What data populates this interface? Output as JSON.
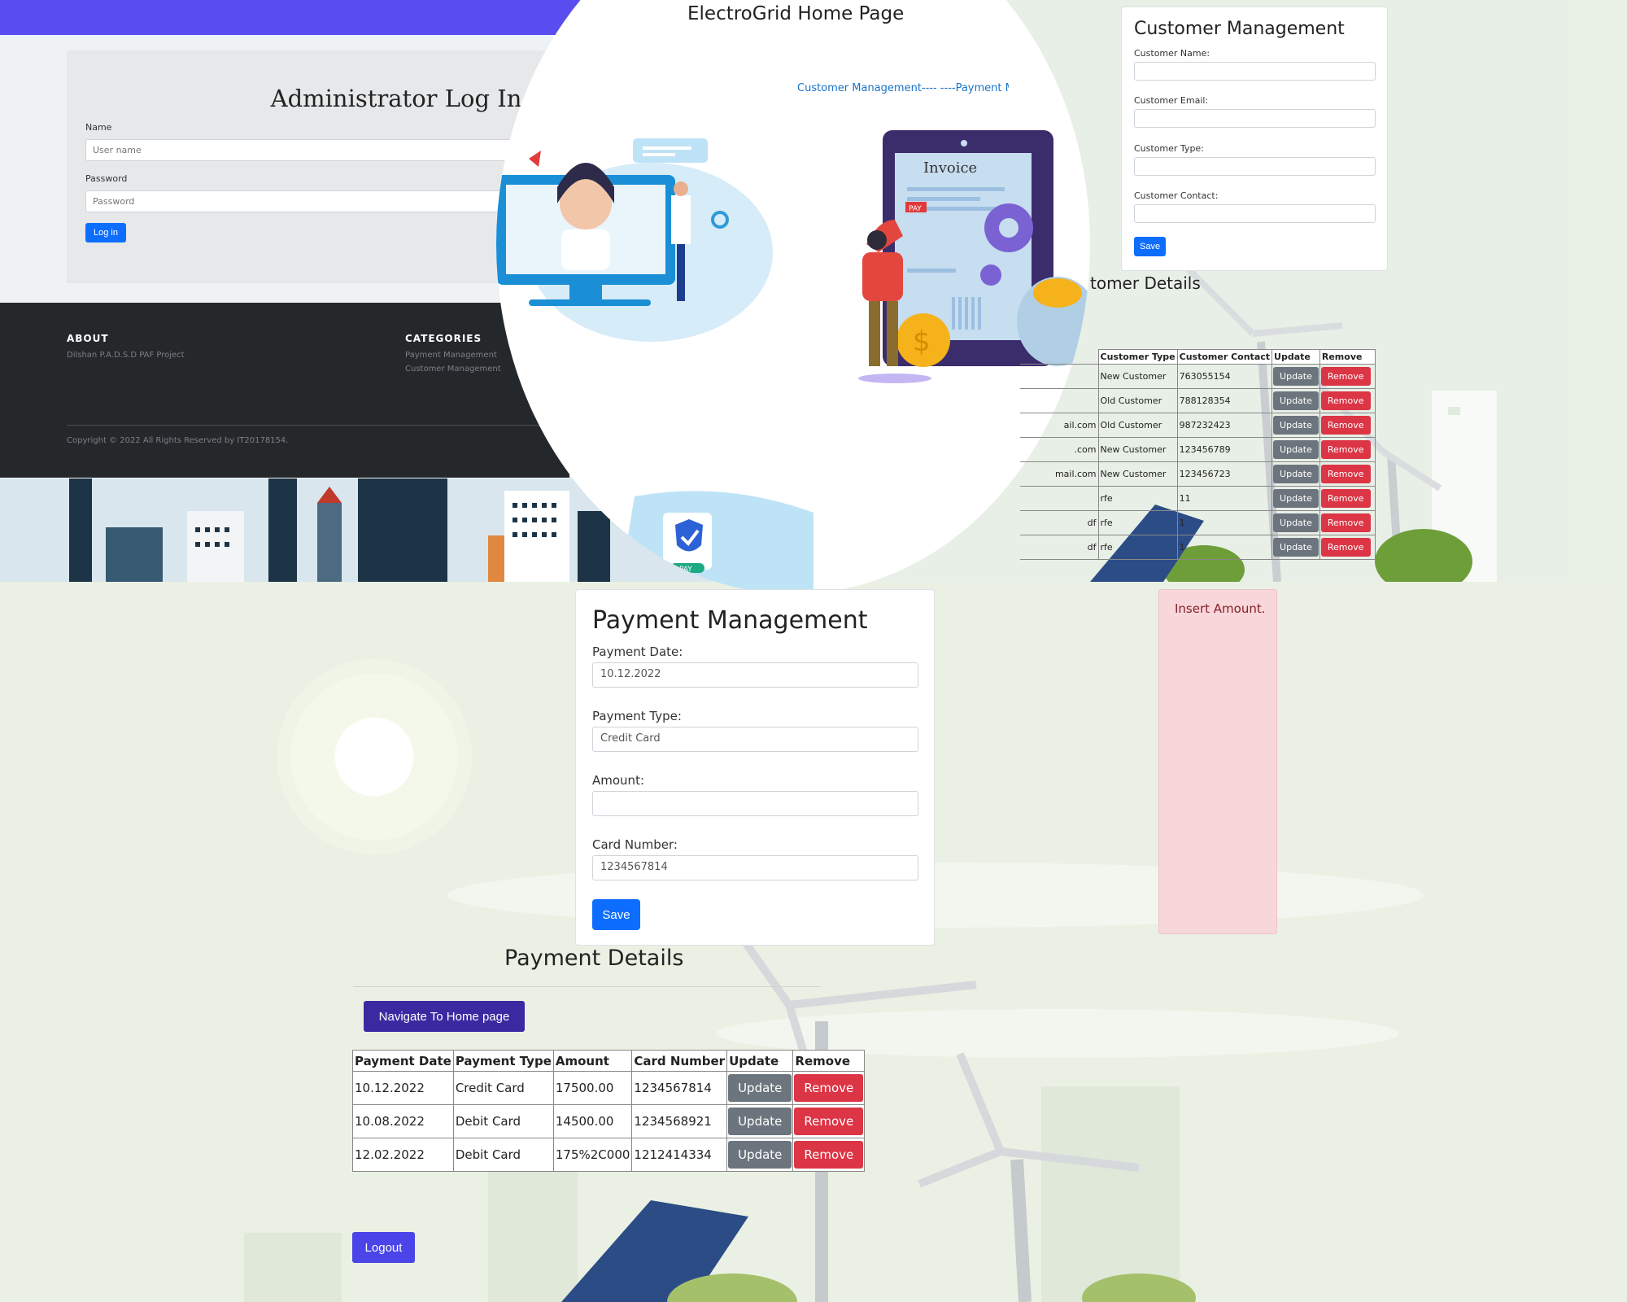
{
  "home": {
    "title": "ElectroGrid Home Page",
    "nav": "Customer Management---- ----Payment Ma"
  },
  "login": {
    "title": "Administrator Log In",
    "name_label": "Name",
    "name_placeholder": "User name",
    "password_label": "Password",
    "password_placeholder": "Password",
    "login_button": "Log in"
  },
  "footer": {
    "about_heading": "ABOUT",
    "about_text": "Dilshan P.A.D.S.D PAF Project",
    "categories_heading": "CATEGORIES",
    "categories": [
      "Payment Management",
      "Customer Management"
    ],
    "copyright": "Copyright © 2022 All Rights Reserved by IT20178154."
  },
  "illustration": {
    "invoice_label": "Invoice",
    "pay_label": "PAY",
    "pay_badge": "PAY"
  },
  "customer_management": {
    "title": "Customer Management",
    "name_label": "Customer Name:",
    "email_label": "Customer Email:",
    "type_label": "Customer Type:",
    "contact_label": "Customer Contact:",
    "save_button": "Save",
    "details_heading": "tomer Details",
    "table_headers": [
      "Customer Type",
      "Customer Contact",
      "Update",
      "Remove"
    ],
    "rows": [
      {
        "email": "",
        "type": "New Customer",
        "contact": "763055154"
      },
      {
        "email": "",
        "type": "Old Customer",
        "contact": "788128354"
      },
      {
        "email": "ail.com",
        "type": "Old Customer",
        "contact": "987232423"
      },
      {
        "email": ".com",
        "type": "New Customer",
        "contact": "123456789"
      },
      {
        "email": "mail.com",
        "type": "New Customer",
        "contact": "123456723"
      },
      {
        "email": "",
        "type": "rfe",
        "contact": "11"
      },
      {
        "email": "df",
        "type": "rfe",
        "contact": "1"
      },
      {
        "email": "df",
        "type": "rfe",
        "contact": "1"
      }
    ],
    "update_label": "Update",
    "remove_label": "Remove"
  },
  "payment_management": {
    "title": "Payment Management",
    "date_label": "Payment Date:",
    "date_value": "10.12.2022",
    "type_label": "Payment Type:",
    "type_value": "Credit Card",
    "amount_label": "Amount:",
    "amount_value": "",
    "card_label": "Card Number:",
    "card_value": "1234567814",
    "save_button": "Save"
  },
  "alert": {
    "text": "Insert Amount."
  },
  "payment_details": {
    "heading": "Payment Details",
    "nav_button": "Navigate To Home page",
    "table_headers": [
      "Payment Date",
      "Payment Type",
      "Amount",
      "Card Number",
      "Update",
      "Remove"
    ],
    "rows": [
      {
        "date": "10.12.2022",
        "type": "Credit Card",
        "amount": "17500.00",
        "card": "1234567814"
      },
      {
        "date": "10.08.2022",
        "type": "Debit Card",
        "amount": "14500.00",
        "card": "1234568921"
      },
      {
        "date": "12.02.2022",
        "type": "Debit Card",
        "amount": "175%2C000",
        "card": "1212414334"
      }
    ],
    "update_label": "Update",
    "remove_label": "Remove",
    "logout_button": "Logout"
  },
  "colors": {
    "primary": "#0d6efd",
    "danger": "#dc3545",
    "secondary": "#6c757d",
    "topbar": "#5a4df0",
    "nav_button": "#3a2aa2",
    "logout": "#4b44e8",
    "alert_bg": "#f8d7da"
  }
}
